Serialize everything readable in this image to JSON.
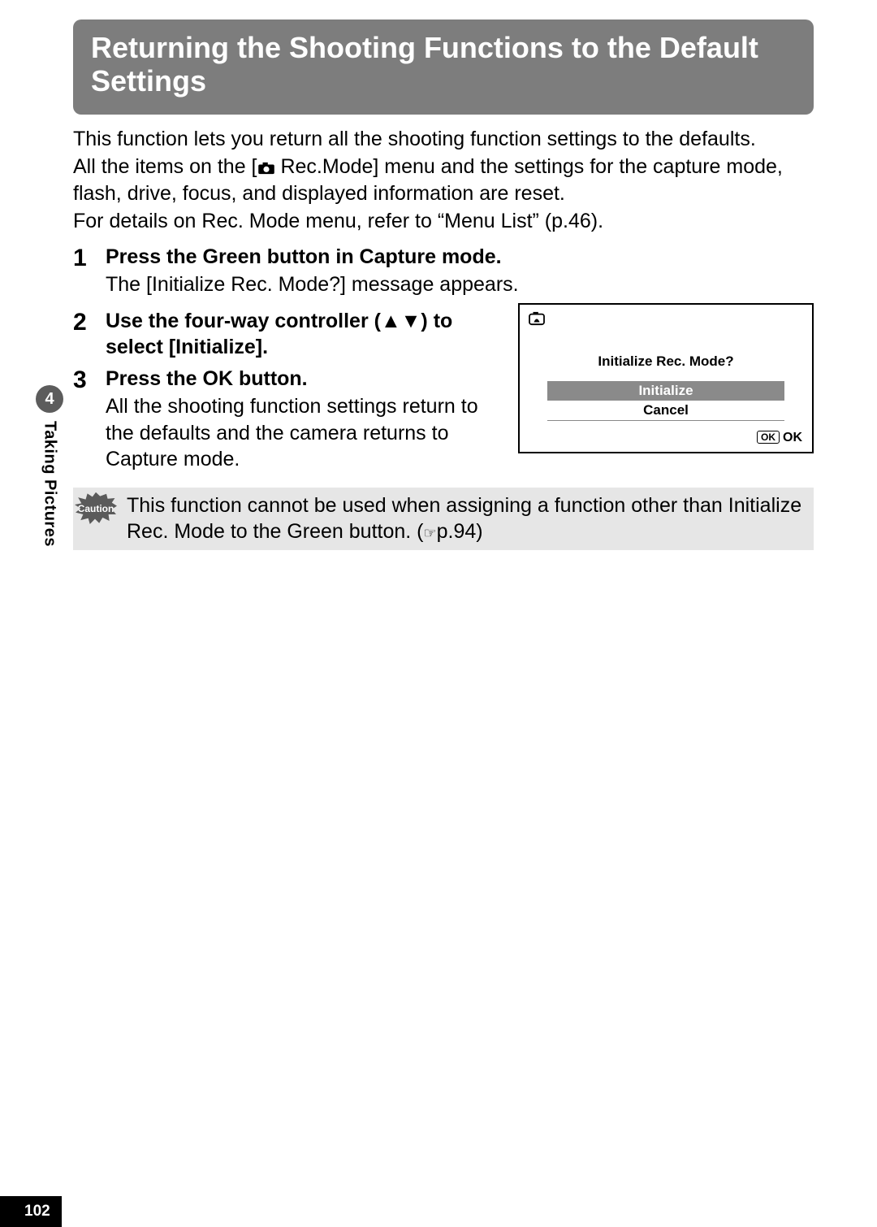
{
  "title": "Returning the Shooting Functions to the Default Settings",
  "intro_lines": {
    "l1": "This function lets you return all the shooting function settings to the defaults.",
    "l2a": "All the items on the [",
    "l2b": " Rec.Mode] menu and the settings for the capture mode, flash, drive, focus, and displayed information are reset.",
    "l3": "For details on Rec. Mode menu, refer to “Menu List” (p.46)."
  },
  "side": {
    "chapter_num": "4",
    "chapter_label": "Taking Pictures"
  },
  "steps": {
    "s1": {
      "num": "1",
      "head": "Press the Green button in Capture mode.",
      "sub": "The [Initialize Rec. Mode?] message appears."
    },
    "s2": {
      "num": "2",
      "head": "Use the four-way controller (▲▼) to select [Initialize]."
    },
    "s3": {
      "num": "3",
      "head": "Press the OK button.",
      "sub": "All the shooting function settings return to the defaults and the camera returns to Capture mode."
    }
  },
  "lcd": {
    "prompt": "Initialize Rec. Mode?",
    "opt_initialize": "Initialize",
    "opt_cancel": "Cancel",
    "ok_badge": "OK",
    "ok_label": "OK"
  },
  "caution": {
    "label": "Caution",
    "text_a": "This function cannot be used when assigning a function other than Initialize Rec. Mode to the Green button. (",
    "text_b": "p.94)"
  },
  "page_number": "102"
}
